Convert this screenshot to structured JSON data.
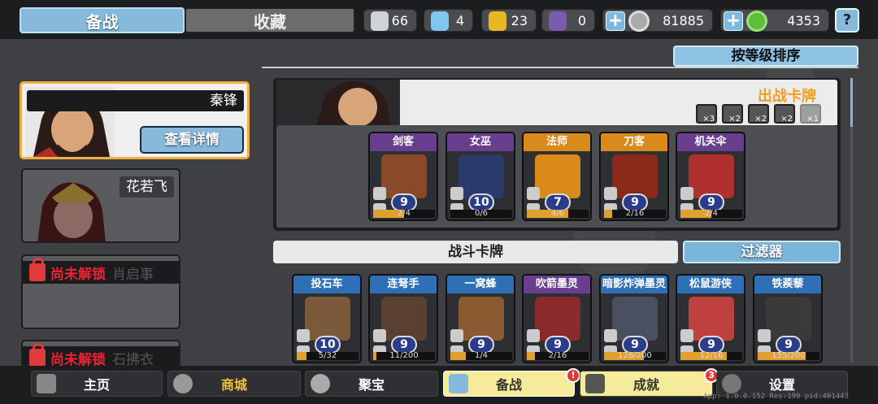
{
  "tabs": {
    "active": "备战",
    "inactive": "收藏"
  },
  "resources": {
    "silver_shield": "66",
    "blue_crystal": "4",
    "gold_shield": "23",
    "purple_badge": "0",
    "coins": "81885",
    "gems": "4353"
  },
  "colors": {
    "accent_blue": "#86b9dc",
    "gold": "#f0a020",
    "alert_red": "#e03a3a",
    "nav_active": "#f5eb9a"
  },
  "sort_button": "按等级排序",
  "heroes": [
    {
      "name": "秦锋",
      "detail_button": "查看详情"
    },
    {
      "name": "花若飞"
    },
    {
      "lock_text": "尚未解锁",
      "name": "肖启事"
    },
    {
      "lock_text": "尚未解锁",
      "name": "石拂衣"
    }
  ],
  "deploy": {
    "title": "出战卡牌",
    "multipliers": [
      "×3",
      "×2",
      "×2",
      "×2",
      "×1"
    ],
    "cards": [
      {
        "label": "剑客",
        "level": "9",
        "progress": "2/4",
        "fill": 0.5,
        "color": "#6a3e8e"
      },
      {
        "label": "女巫",
        "level": "10",
        "progress": "0/6",
        "fill": 0.0,
        "color": "#6a3e8e"
      },
      {
        "label": "法师",
        "level": "7",
        "progress": "4/6",
        "fill": 0.67,
        "color": "#d98a1a"
      },
      {
        "label": "刀客",
        "level": "9",
        "progress": "2/16",
        "fill": 0.125,
        "color": "#d98a1a"
      },
      {
        "label": "机关伞",
        "level": "9",
        "progress": "2/4",
        "fill": 0.5,
        "color": "#6a3e8e"
      }
    ]
  },
  "battle": {
    "title": "战斗卡牌",
    "filter_button": "过滤器",
    "cards": [
      {
        "label": "投石车",
        "level": "10",
        "progress": "5/32",
        "fill": 0.16,
        "color": "#2f6fb6"
      },
      {
        "label": "连弩手",
        "level": "9",
        "progress": "11/200",
        "fill": 0.05,
        "color": "#2f6fb6"
      },
      {
        "label": "一窝蜂",
        "level": "9",
        "progress": "1/4",
        "fill": 0.25,
        "color": "#2f6fb6"
      },
      {
        "label": "吹箭墨灵",
        "level": "9",
        "progress": "2/16",
        "fill": 0.125,
        "color": "#6a3e8e"
      },
      {
        "label": "暗影炸弹墨灵",
        "level": "9",
        "progress": "128/200",
        "fill": 0.64,
        "color": "#2f6fb6"
      },
      {
        "label": "松鼠游侠",
        "level": "9",
        "progress": "12/16",
        "fill": 0.75,
        "color": "#2f6fb6"
      },
      {
        "label": "铁蒺藜",
        "level": "9",
        "progress": "155/200",
        "fill": 0.78,
        "color": "#2f6fb6"
      }
    ]
  },
  "nav": [
    {
      "label": "主页",
      "icon": "home-icon"
    },
    {
      "label": "商城",
      "icon": "coins-icon"
    },
    {
      "label": "聚宝",
      "icon": "treasure-icon"
    },
    {
      "label": "备战",
      "icon": "card-icon",
      "badge": "!"
    },
    {
      "label": "成就",
      "icon": "achievement-icon",
      "badge": "3"
    },
    {
      "label": "设置",
      "icon": "gear-icon"
    }
  ],
  "version": "App: 1.0.0.152 Res:190 pid:401443"
}
